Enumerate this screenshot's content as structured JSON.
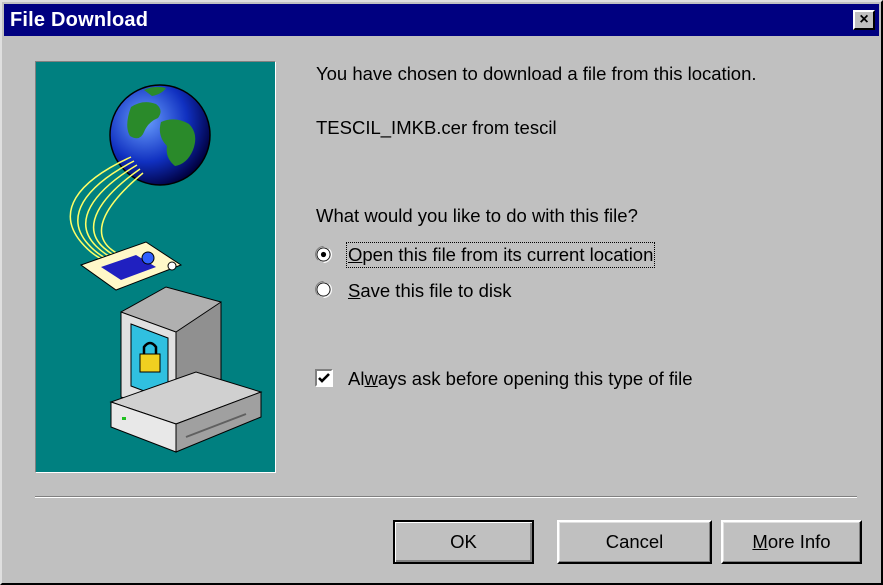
{
  "window": {
    "title": "File Download",
    "close_label": "×"
  },
  "message": {
    "intro": "You have chosen to download a file from this location.",
    "file_line": "TESCIL_IMKB.cer from tescil",
    "question": "What would you like to do with this file?"
  },
  "options": {
    "open": {
      "prefix": "",
      "mnemonic": "O",
      "rest": "pen this file from its current location",
      "checked": true
    },
    "save": {
      "prefix": "",
      "mnemonic": "S",
      "rest": "ave this file to disk",
      "checked": false
    }
  },
  "always_ask": {
    "prefix": "Al",
    "mnemonic": "w",
    "rest": "ays ask before opening this type of file",
    "checked": true
  },
  "buttons": {
    "ok": "OK",
    "cancel": "Cancel",
    "more_info": {
      "mnemonic": "M",
      "rest": "ore Info"
    }
  },
  "colors": {
    "titlebar": "#000080",
    "dialog": "#c0c0c0",
    "illustration_bg": "#008080"
  }
}
